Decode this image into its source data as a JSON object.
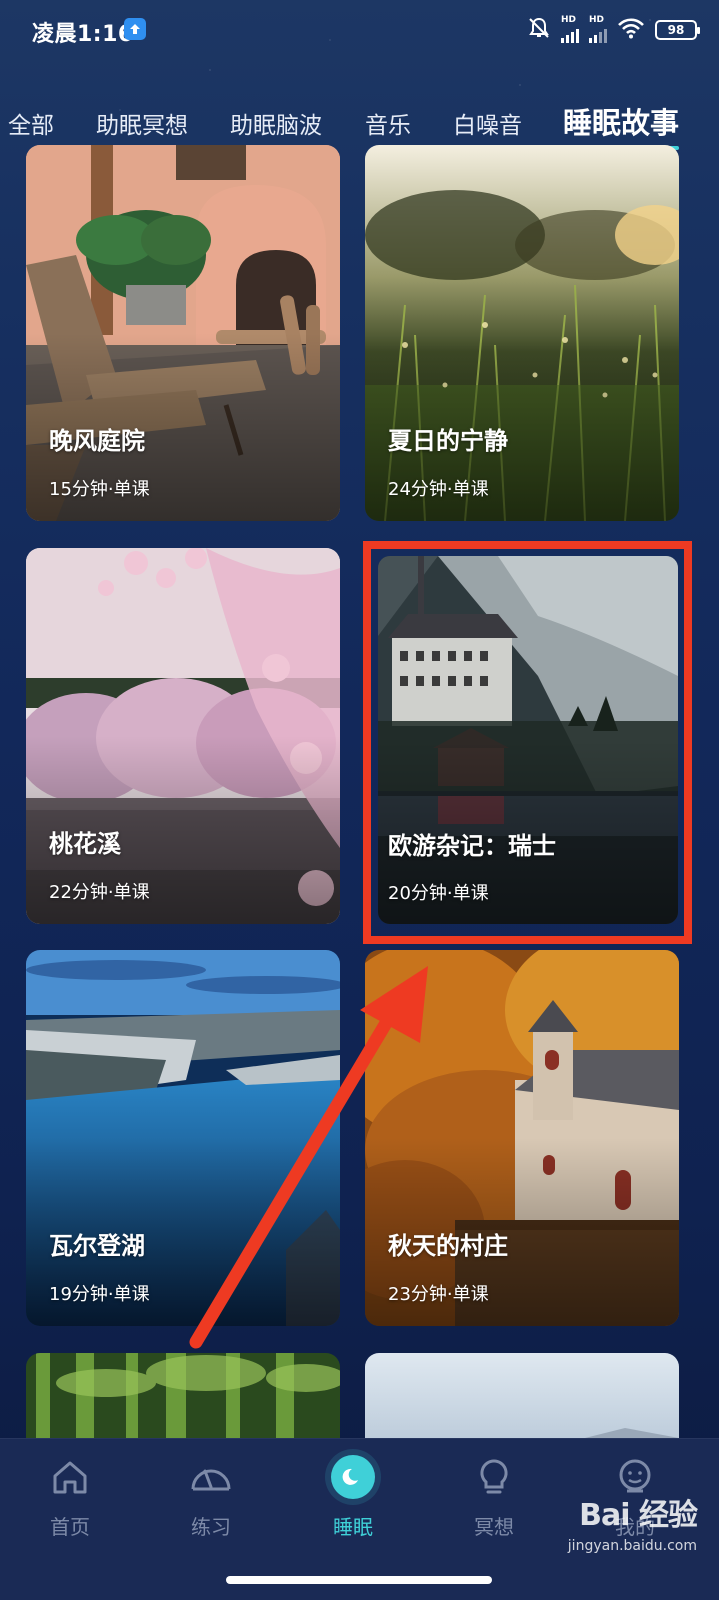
{
  "status_bar": {
    "time": "凌晨1:16",
    "battery": "98",
    "signal_tag_1": "HD",
    "signal_tag_2": "HD"
  },
  "tabs": [
    {
      "label": "全部",
      "active": false
    },
    {
      "label": "助眠冥想",
      "active": false
    },
    {
      "label": "助眠脑波",
      "active": false
    },
    {
      "label": "音乐",
      "active": false
    },
    {
      "label": "白噪音",
      "active": false
    },
    {
      "label": "睡眠故事",
      "active": true
    }
  ],
  "cards": [
    {
      "title": "晚风庭院",
      "meta": "15分钟·单课"
    },
    {
      "title": "夏日的宁静",
      "meta": "24分钟·单课"
    },
    {
      "title": "桃花溪",
      "meta": "22分钟·单课"
    },
    {
      "title": "欧游杂记：瑞士",
      "meta": "20分钟·单课"
    },
    {
      "title": "瓦尔登湖",
      "meta": "19分钟·单课"
    },
    {
      "title": "秋天的村庄",
      "meta": "23分钟·单课"
    }
  ],
  "bottom_nav": [
    {
      "label": "首页",
      "icon": "home-icon",
      "active": false
    },
    {
      "label": "练习",
      "icon": "gauge-icon",
      "active": false
    },
    {
      "label": "睡眠",
      "icon": "moon-icon",
      "active": true
    },
    {
      "label": "冥想",
      "icon": "lightbulb-icon",
      "active": false
    },
    {
      "label": "我的",
      "icon": "profile-icon",
      "active": false
    }
  ],
  "watermark": {
    "logo": "Bai 经验",
    "url": "jingyan.baidu.com"
  },
  "colors": {
    "accent": "#3fd0d8",
    "highlight": "#ee3a22",
    "background": "#12285a",
    "nav_inactive": "#7d8aa8"
  }
}
